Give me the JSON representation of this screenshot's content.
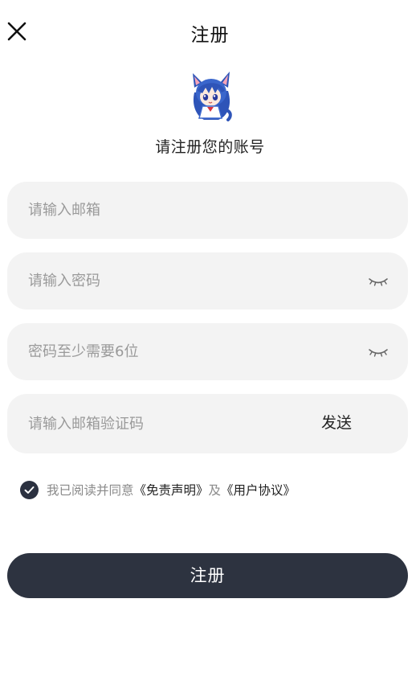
{
  "header": {
    "title": "注册",
    "close_icon": "close-icon"
  },
  "mascot": {
    "icon": "mascot-avatar"
  },
  "subtitle": "请注册您的账号",
  "form": {
    "email": {
      "placeholder": "请输入邮箱",
      "value": ""
    },
    "password": {
      "placeholder": "请输入密码",
      "value": "",
      "toggle_icon": "eye-closed-icon"
    },
    "confirm_password": {
      "placeholder": "密码至少需要6位",
      "value": "",
      "toggle_icon": "eye-closed-icon"
    },
    "verify_code": {
      "placeholder": "请输入邮箱验证码",
      "value": "",
      "send_label": "发送"
    }
  },
  "agreement": {
    "checked": true,
    "prefix": "我已阅读并同意",
    "disclaimer_link": "《免责声明》",
    "and_text": "及",
    "user_agreement_link": "《用户协议》"
  },
  "submit_label": "注册",
  "colors": {
    "primary": "#2d3340",
    "field_bg": "#f3f3f3",
    "placeholder": "#9a9a9a",
    "muted_text": "#8a8a8a"
  }
}
